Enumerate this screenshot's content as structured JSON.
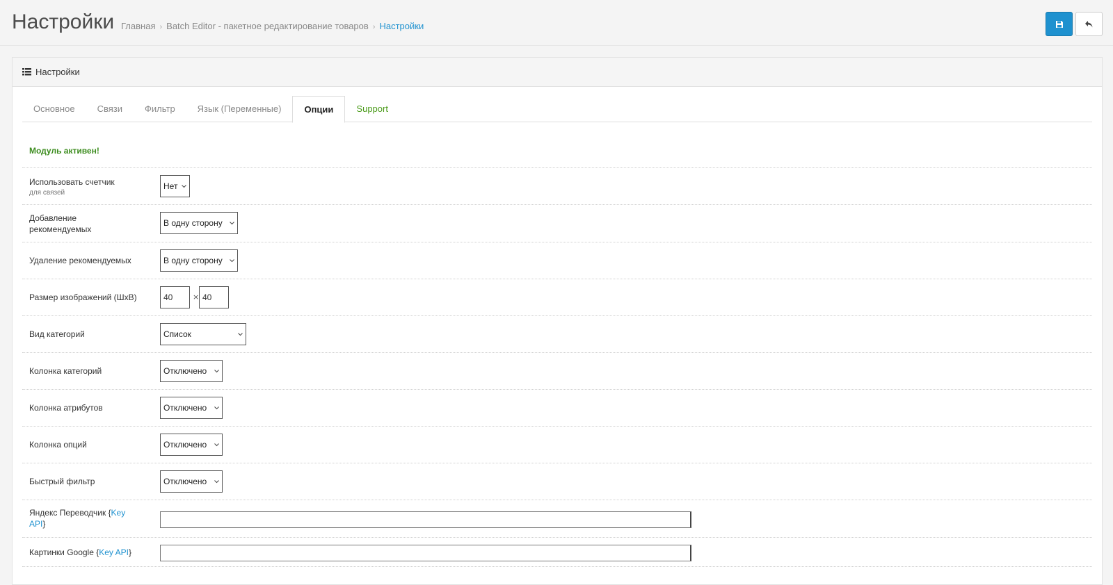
{
  "header": {
    "title": "Настройки",
    "breadcrumb": [
      "Главная",
      "Batch Editor - пакетное редактирование товаров",
      "Настройки"
    ]
  },
  "buttons": {
    "save_icon": "floppy-disk-icon",
    "back_icon": "reply-arrow-icon"
  },
  "panel": {
    "heading": "Настройки",
    "heading_icon": "list-icon"
  },
  "tabs": [
    "Основное",
    "Связи",
    "Фильтр",
    "Язык (Переменные)",
    "Опции",
    "Support"
  ],
  "active_tab": "Опции",
  "status": "Модуль активен!",
  "fields": {
    "counter": {
      "label": "Использовать счетчик",
      "hint": "для связей",
      "value": "Нет"
    },
    "add_related": {
      "label": "Добавление рекомендуемых",
      "value": "В одну сторону"
    },
    "del_related": {
      "label": "Удаление рекомендуемых",
      "value": "В одну сторону"
    },
    "image_size": {
      "label": "Размер изображений (ШxВ)",
      "width": "40",
      "sep": "×",
      "height": "40"
    },
    "category_view": {
      "label": "Вид категорий",
      "value": "Список"
    },
    "category_column": {
      "label": "Колонка категорий",
      "value": "Отключено"
    },
    "attribute_column": {
      "label": "Колонка атрибутов",
      "value": "Отключено"
    },
    "option_column": {
      "label": "Колонка опций",
      "value": "Отключено"
    },
    "quick_filter": {
      "label": "Быстрый фильтр",
      "value": "Отключено"
    },
    "yandex": {
      "label_pre": "Яндекс Переводчик {",
      "link": "Key API",
      "label_post": "}",
      "value": ""
    },
    "google": {
      "label_pre": "Картинки Google {",
      "link": "Key API",
      "label_post": "}",
      "value": ""
    }
  },
  "colors": {
    "accent": "#1e91cf",
    "success": "#3c8c1e"
  }
}
